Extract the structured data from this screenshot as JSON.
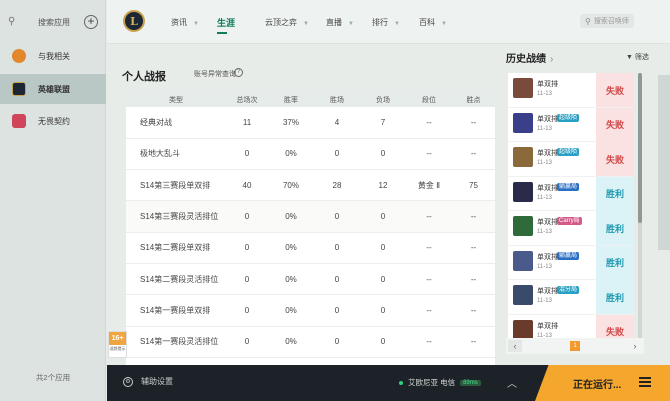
{
  "sidebar": {
    "search_label": "搜索应用",
    "items": [
      {
        "label": "与我相关",
        "color": "#e2882a"
      },
      {
        "label": "英雄联盟",
        "color": "#1c2733"
      },
      {
        "label": "无畏契约",
        "color": "#d0455a"
      }
    ],
    "footer": "共2个应用"
  },
  "topnav": {
    "logo_text": "L",
    "items": [
      {
        "label": "资讯",
        "caret": "▼"
      },
      {
        "label": "生涯",
        "caret": ""
      },
      {
        "label": "云顶之弈",
        "caret": "▼"
      },
      {
        "label": "直播",
        "caret": "▼"
      },
      {
        "label": "排行",
        "caret": "▼"
      },
      {
        "label": "百科",
        "caret": "▼"
      }
    ],
    "search_placeholder": "搜索召唤师"
  },
  "stats": {
    "title": "个人战报",
    "subtitle": "账号异常查询",
    "columns": [
      "类型",
      "总场次",
      "胜率",
      "胜场",
      "负场",
      "段位",
      "胜点"
    ],
    "rows": [
      [
        "经典对战",
        "11",
        "37%",
        "4",
        "7",
        "--",
        "--"
      ],
      [
        "极地大乱斗",
        "0",
        "0%",
        "0",
        "0",
        "--",
        "--"
      ],
      [
        "S14第三赛段单双排",
        "40",
        "70%",
        "28",
        "12",
        "黄金 Ⅱ",
        "75"
      ],
      [
        "S14第三赛段灵活排位",
        "0",
        "0%",
        "0",
        "0",
        "--",
        "--"
      ],
      [
        "S14第二赛段单双排",
        "0",
        "0%",
        "0",
        "0",
        "--",
        "--"
      ],
      [
        "S14第二赛段灵活排位",
        "0",
        "0%",
        "0",
        "0",
        "--",
        "--"
      ],
      [
        "S14第一赛段单双排",
        "0",
        "0%",
        "0",
        "0",
        "--",
        "--"
      ],
      [
        "S14第一赛段灵活排位",
        "0",
        "0%",
        "0",
        "0",
        "--",
        "--"
      ]
    ]
  },
  "history": {
    "title": "历史战绩",
    "filter_label": "筛选",
    "matches": [
      {
        "mode": "单双排",
        "tag": "",
        "tag_color": "",
        "date": "11-13",
        "result": "失败",
        "win": false,
        "champ_color": "#7a4a3a"
      },
      {
        "mode": "单双排",
        "tag": "超级陨",
        "tag_color": "#2a9fc4",
        "date": "11-13",
        "result": "失败",
        "win": false,
        "champ_color": "#3a3f8a"
      },
      {
        "mode": "单双排",
        "tag": "超级陨",
        "tag_color": "#2a9fc4",
        "date": "11-13",
        "result": "失败",
        "win": false,
        "champ_color": "#8a6a3a"
      },
      {
        "mode": "单双排",
        "tag": "躺赢局",
        "tag_color": "#2a6fc4",
        "date": "11-13",
        "result": "胜利",
        "win": true,
        "champ_color": "#2a2a4a"
      },
      {
        "mode": "单双排",
        "tag": "Carry局",
        "tag_color": "#d45a8a",
        "date": "11-13",
        "result": "胜利",
        "win": true,
        "champ_color": "#2e6a3a"
      },
      {
        "mode": "单双排",
        "tag": "躺赢局",
        "tag_color": "#2a6fc4",
        "date": "11-13",
        "result": "胜利",
        "win": true,
        "champ_color": "#4a5a8a"
      },
      {
        "mode": "单双排",
        "tag": "混分局",
        "tag_color": "#2a9fc4",
        "date": "11-13",
        "result": "胜利",
        "win": true,
        "champ_color": "#3a4a6a"
      },
      {
        "mode": "单双排",
        "tag": "",
        "tag_color": "",
        "date": "11-13",
        "result": "失败",
        "win": false,
        "champ_color": "#6a3a2a"
      }
    ],
    "current_page": "1"
  },
  "bottombar": {
    "settings_label": "辅助设置",
    "server": "艾欧尼亚 电信",
    "ping": "89ms",
    "running_label": "正在运行..."
  },
  "age_badge": {
    "rating": "16+",
    "note": "适龄提示"
  }
}
